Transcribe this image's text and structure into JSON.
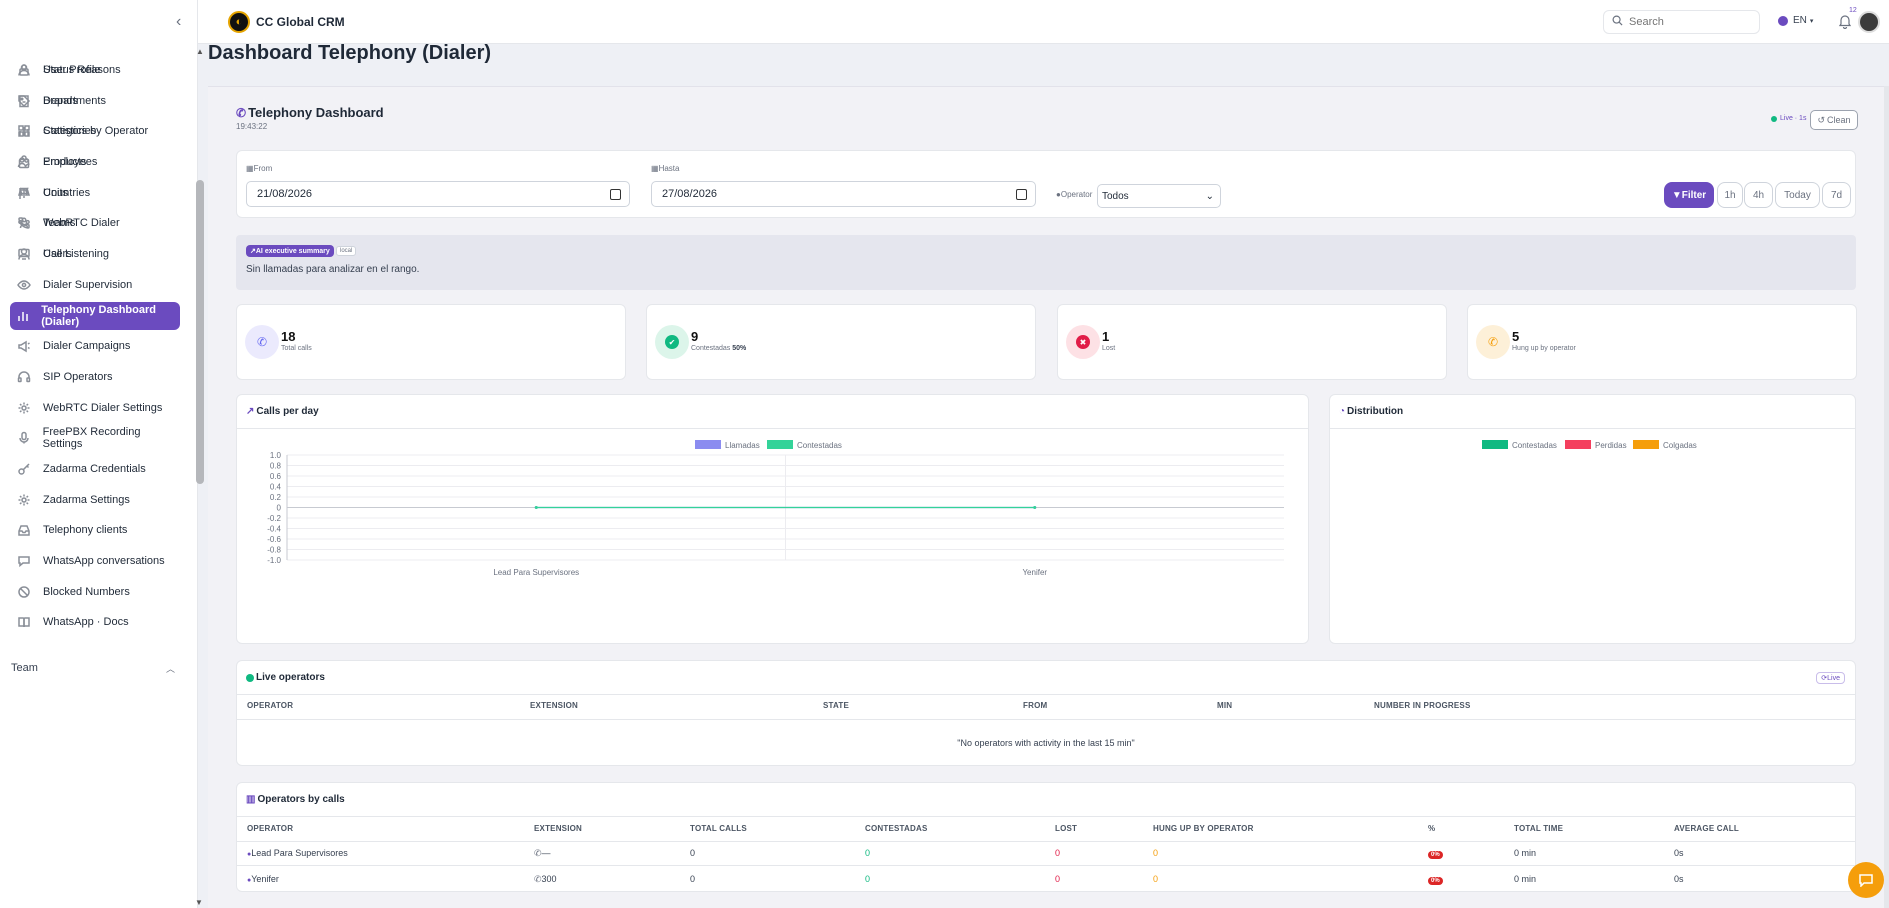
{
  "app": {
    "name": "CC Global CRM"
  },
  "topbar": {
    "search_placeholder": "Search",
    "language": "EN",
    "notification_count": "12"
  },
  "sidebar": {
    "items": [
      {
        "label": "Status Reasons",
        "icon": "lock-icon"
      },
      {
        "label": "Brands",
        "icon": "tag-icon"
      },
      {
        "label": "Categories",
        "icon": "grid-icon"
      },
      {
        "label": "Products",
        "icon": "bag-icon"
      },
      {
        "label": "Units",
        "icon": "scale-icon"
      },
      {
        "label": "WebRTC Dialer",
        "icon": "phone-icon"
      },
      {
        "label": "Call Listening",
        "icon": "monitor-icon"
      },
      {
        "label": "Dialer Supervision",
        "icon": "eye-icon"
      },
      {
        "label": "Telephony Dashboard (Dialer)",
        "icon": "bar-chart-icon"
      },
      {
        "label": "Dialer Campaigns",
        "icon": "megaphone-icon"
      },
      {
        "label": "SIP Operators",
        "icon": "headset-icon"
      },
      {
        "label": "WebRTC Dialer Settings",
        "icon": "gear-icon"
      },
      {
        "label": "FreePBX Recording Settings",
        "icon": "mic-icon"
      },
      {
        "label": "Zadarma Credentials",
        "icon": "key-icon"
      },
      {
        "label": "Zadarma Settings",
        "icon": "gear-icon"
      },
      {
        "label": "Telephony clients",
        "icon": "inbox-icon"
      },
      {
        "label": "WhatsApp conversations",
        "icon": "chat-icon"
      },
      {
        "label": "Blocked Numbers",
        "icon": "block-icon"
      },
      {
        "label": "WhatsApp · Docs",
        "icon": "book-icon"
      }
    ],
    "team_section": "Team",
    "team_items": [
      {
        "label": "User Profile",
        "icon": "user-icon"
      },
      {
        "label": "Departments",
        "icon": "building-icon"
      },
      {
        "label": "Statistics by Operator",
        "icon": "bar-chart-icon"
      },
      {
        "label": "Employees",
        "icon": "users-icon"
      },
      {
        "label": "Countries",
        "icon": "flag-icon"
      },
      {
        "label": "Teams",
        "icon": "team-icon"
      },
      {
        "label": "Users",
        "icon": "user-icon"
      }
    ]
  },
  "page": {
    "title": "Dashboard Telephony (Dialer)"
  },
  "dashboard": {
    "title": "Telephony Dashboard",
    "time": "19:43:22",
    "live_label": "Live · 1s",
    "clean_label": "Clean"
  },
  "filters": {
    "from_label": "From",
    "from_value": "21/08/2026",
    "to_label": "Hasta",
    "to_value": "27/08/2026",
    "operator_label": "Operator",
    "operator_value": "Todos",
    "filter_btn": "Filter",
    "quick": [
      "1h",
      "4h",
      "Today",
      "7d"
    ]
  },
  "ai": {
    "tag": "AI executive summary",
    "local": "local",
    "text": "Sin llamadas para analizar en el rango."
  },
  "stats": [
    {
      "value": "18",
      "label": "Total calls",
      "extra": "",
      "color": "#6366f1",
      "bg": "#ebeafd",
      "icon": "phone-icon"
    },
    {
      "value": "9",
      "label": "Contestadas",
      "extra": "50%",
      "color": "#10b981",
      "bg": "#dcf5ea",
      "icon": "check-icon"
    },
    {
      "value": "1",
      "label": "Lost",
      "extra": "",
      "color": "#e11d48",
      "bg": "#fde1e5",
      "icon": "x-icon"
    },
    {
      "value": "5",
      "label": "Hung up by operator",
      "extra": "",
      "color": "#f59e0b",
      "bg": "#fdf0d8",
      "icon": "phone-icon"
    }
  ],
  "charts_titles": {
    "calls_per_day": "Calls per day",
    "distribution": "Distribution"
  },
  "chart_data": [
    {
      "type": "line",
      "title": "Calls per day",
      "categories": [
        "Lead Para Supervisores",
        "Yenifer"
      ],
      "series": [
        {
          "name": "Llamadas",
          "values": [
            0,
            0
          ],
          "color": "#8b8cf0"
        },
        {
          "name": "Contestadas",
          "values": [
            0,
            0
          ],
          "color": "#34d399"
        }
      ],
      "ylim": [
        -1.0,
        1.0
      ],
      "yticks": [
        "1.0",
        "0.8",
        "0.6",
        "0.4",
        "0.2",
        "0",
        "-0.2",
        "-0.4",
        "-0.6",
        "-0.8",
        "-1.0"
      ],
      "grid": true,
      "legend": "top-center"
    },
    {
      "type": "pie",
      "title": "Distribution",
      "series": [
        {
          "name": "Contestadas",
          "value": 0,
          "color": "#10b981"
        },
        {
          "name": "Perdidas",
          "value": 0,
          "color": "#f43f5e"
        },
        {
          "name": "Colgadas",
          "value": 0,
          "color": "#f59e0b"
        }
      ],
      "legend": "top-center"
    }
  ],
  "live_operators": {
    "title": "Live operators",
    "live_pill": "Live",
    "columns": [
      "OPERATOR",
      "EXTENSION",
      "STATE",
      "FROM",
      "MIN",
      "NUMBER IN PROGRESS"
    ],
    "empty": "\"No operators with activity in the last 15 min\""
  },
  "operators_by_calls": {
    "title": "Operators by calls",
    "columns": [
      "OPERATOR",
      "EXTENSION",
      "TOTAL CALLS",
      "CONTESTADAS",
      "LOST",
      "HUNG UP BY OPERATOR",
      "%",
      "TOTAL TIME",
      "AVERAGE CALL"
    ],
    "rows": [
      {
        "operator": "Lead Para Supervisores",
        "extension": "—",
        "total": "0",
        "answered": "0",
        "lost": "0",
        "hung": "0",
        "pct": "0%",
        "time": "0 min",
        "avg": "0s"
      },
      {
        "operator": "Yenifer",
        "extension": "300",
        "total": "0",
        "answered": "0",
        "lost": "0",
        "hung": "0",
        "pct": "0%",
        "time": "0 min",
        "avg": "0s"
      }
    ]
  }
}
